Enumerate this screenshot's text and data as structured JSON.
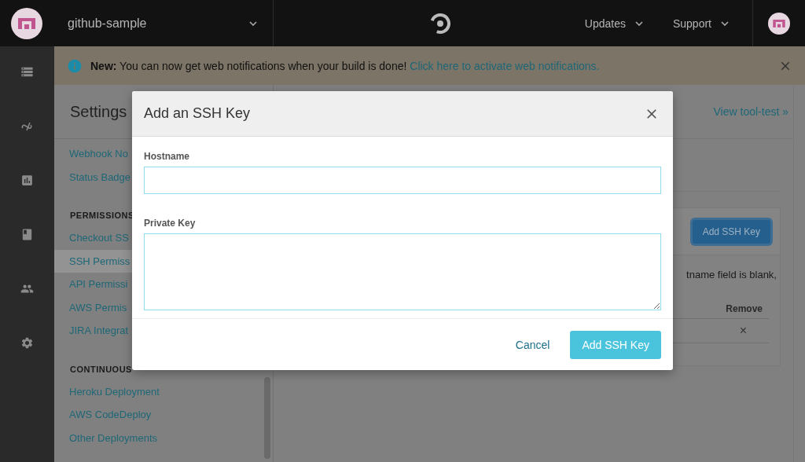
{
  "topbar": {
    "project": "github-sample",
    "menus": [
      {
        "label": "Updates"
      },
      {
        "label": "Support"
      }
    ]
  },
  "banner": {
    "message": "**New:** You can now get web notifications when your build is done!",
    "link": "Click here to activate web notifications."
  },
  "settings_nav": {
    "title": "Settings",
    "sections": [
      {
        "items": [
          {
            "label": "Webhook No",
            "selected": false
          },
          {
            "label": "Status Badge",
            "selected": false
          }
        ]
      },
      {
        "heading": "PERMISSIONS",
        "items": [
          {
            "label": "Checkout SS",
            "selected": false
          },
          {
            "label": "SSH Permiss",
            "selected": true
          },
          {
            "label": "API Permissi",
            "selected": false
          },
          {
            "label": "AWS Permis",
            "selected": false
          },
          {
            "label": "JIRA Integrat",
            "selected": false
          }
        ]
      },
      {
        "heading": "CONTINUOUS",
        "items": [
          {
            "label": "Heroku Deployment",
            "selected": false
          },
          {
            "label": "AWS CodeDeploy",
            "selected": false
          },
          {
            "label": "Other Deployments",
            "selected": false
          }
        ]
      }
    ]
  },
  "main": {
    "view_link": "View tool-test »",
    "card_button": "Add SSH Key",
    "note": "tname field is blank,",
    "table": {
      "columns": [
        "Remove"
      ],
      "rows": [
        {
          "remove": "×"
        }
      ]
    }
  },
  "modal": {
    "title": "Add an SSH Key",
    "fields": [
      {
        "label": "Hostname",
        "kind": "input"
      },
      {
        "label": "Private Key",
        "kind": "textarea"
      }
    ],
    "cancel": "Cancel",
    "submit": "Add SSH Key"
  }
}
